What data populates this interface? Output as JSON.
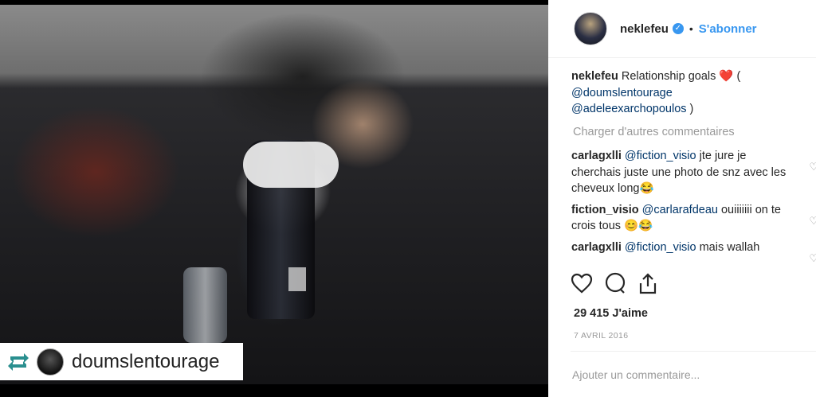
{
  "photo": {
    "repost_user": "doumslentourage",
    "repost_icon": "repost-icon"
  },
  "header": {
    "username": "neklefeu",
    "separator": "•",
    "follow_label": "S'abonner",
    "verified_icon": "verified-badge-icon"
  },
  "caption": {
    "user": "neklefeu",
    "text": "Relationship goals ❤️ (",
    "mention1": "@doumslentourage",
    "mention2": "@adeleexarchopoulos",
    "close": " )"
  },
  "load_more": "Charger d'autres commentaires",
  "comments": [
    {
      "user": "carlagxlli",
      "mention": "@fiction_visio",
      "text": " jte jure je cherchais juste une photo de snz avec les cheveux long😂"
    },
    {
      "user": "fiction_visio",
      "mention": "@carlarafdeau",
      "text": " ouiiiiiii on te crois tous 😊😂"
    },
    {
      "user": "carlagxlli",
      "mention": "@fiction_visio",
      "text": " mais wallah"
    }
  ],
  "likes": "29 415 J'aime",
  "date": "7 AVRIL 2016",
  "add_comment_placeholder": "Ajouter un commentaire...",
  "colors": {
    "accent": "#3897f0",
    "text": "#262626",
    "muted": "#999999"
  }
}
